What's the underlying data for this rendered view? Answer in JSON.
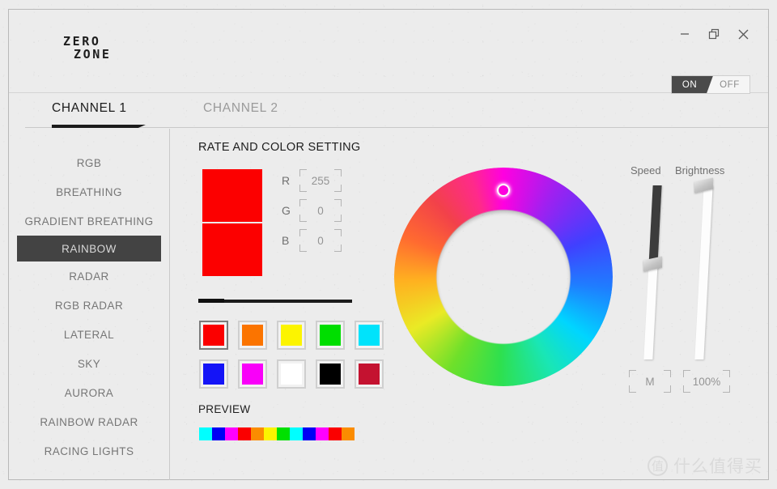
{
  "app": {
    "logo_line1": "ZERO",
    "logo_line2": "ZONE"
  },
  "titlebar": {
    "minimize_icon": "minimize-icon",
    "restore_icon": "restore-icon",
    "close_icon": "close-icon"
  },
  "power_toggle": {
    "on_label": "ON",
    "off_label": "OFF",
    "state": "ON"
  },
  "tabs": [
    {
      "label": "CHANNEL 1",
      "active": true
    },
    {
      "label": "CHANNEL 2",
      "active": false
    }
  ],
  "sidebar": {
    "items": [
      {
        "label": "RGB",
        "active": false
      },
      {
        "label": "BREATHING",
        "active": false
      },
      {
        "label": "GRADIENT BREATHING",
        "active": false
      },
      {
        "label": "RAINBOW",
        "active": true
      },
      {
        "label": "RADAR",
        "active": false
      },
      {
        "label": "RGB RADAR",
        "active": false
      },
      {
        "label": "LATERAL",
        "active": false
      },
      {
        "label": "SKY",
        "active": false
      },
      {
        "label": "AURORA",
        "active": false
      },
      {
        "label": "RAINBOW RADAR",
        "active": false
      },
      {
        "label": "RACING LIGHTS",
        "active": false
      }
    ]
  },
  "main": {
    "rate_and_color_title": "RATE AND COLOR SETTING",
    "preview_title": "PREVIEW",
    "current_color": "#fc0000",
    "rgb_fields": [
      {
        "label": "R",
        "value": "255"
      },
      {
        "label": "G",
        "value": "0"
      },
      {
        "label": "B",
        "value": "0"
      }
    ],
    "rate_slider": {
      "percent": 17
    },
    "swatches": [
      {
        "color": "#fb0000",
        "selected": true
      },
      {
        "color": "#fb7400",
        "selected": false
      },
      {
        "color": "#fcf400",
        "selected": false
      },
      {
        "color": "#00de00",
        "selected": false
      },
      {
        "color": "#00e3fb",
        "selected": false
      },
      {
        "color": "#1414f7",
        "selected": false
      },
      {
        "color": "#f900f9",
        "selected": false
      },
      {
        "color": "#ffffff",
        "selected": false
      },
      {
        "color": "#000000",
        "selected": false
      },
      {
        "color": "#c41230",
        "selected": false
      }
    ],
    "preview_strip": [
      "#00ffff",
      "#0000f5",
      "#ff00ff",
      "#fb0000",
      "#fb8c00",
      "#fcf400",
      "#00e000",
      "#00ffff",
      "#0000f5",
      "#ff00ff",
      "#fb0000",
      "#fb8c00"
    ],
    "color_wheel": {
      "name": "hue-wheel",
      "selected_hue_deg": 0,
      "selected_color": "#ff00e0"
    },
    "speed_slider": {
      "label": "Speed",
      "value": "M",
      "percent": 45
    },
    "brightness_slider": {
      "label": "Brightness",
      "value": "100%",
      "percent": 100
    }
  },
  "watermark": {
    "badge": "值",
    "text": "什么值得买"
  }
}
